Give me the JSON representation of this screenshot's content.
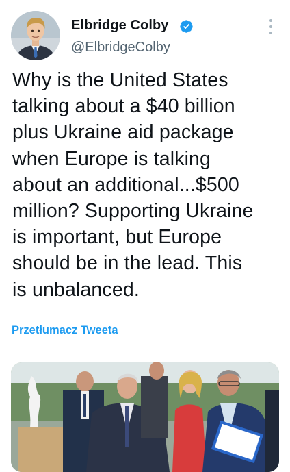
{
  "tweet": {
    "author": {
      "display_name": "Elbridge Colby",
      "handle": "@ElbridgeColby",
      "verified_icon": "verified-badge-icon",
      "avatar_icon": "user-avatar"
    },
    "more_icon": "more-options-icon",
    "text": "Why is the United States\ntalking about a $40 billion\nplus Ukraine aid package\nwhen Europe is talking\nabout an additional...$500\nmillion? Supporting Ukraine\nis important, but Europe\nshould be in the lead. This\nis unbalanced.",
    "translate_link": "Przetłumacz Tweeta",
    "media": {
      "type": "photo"
    }
  },
  "colors": {
    "accent": "#1d9bf0",
    "secondary_text": "#536471",
    "primary_text": "#0f1419"
  }
}
